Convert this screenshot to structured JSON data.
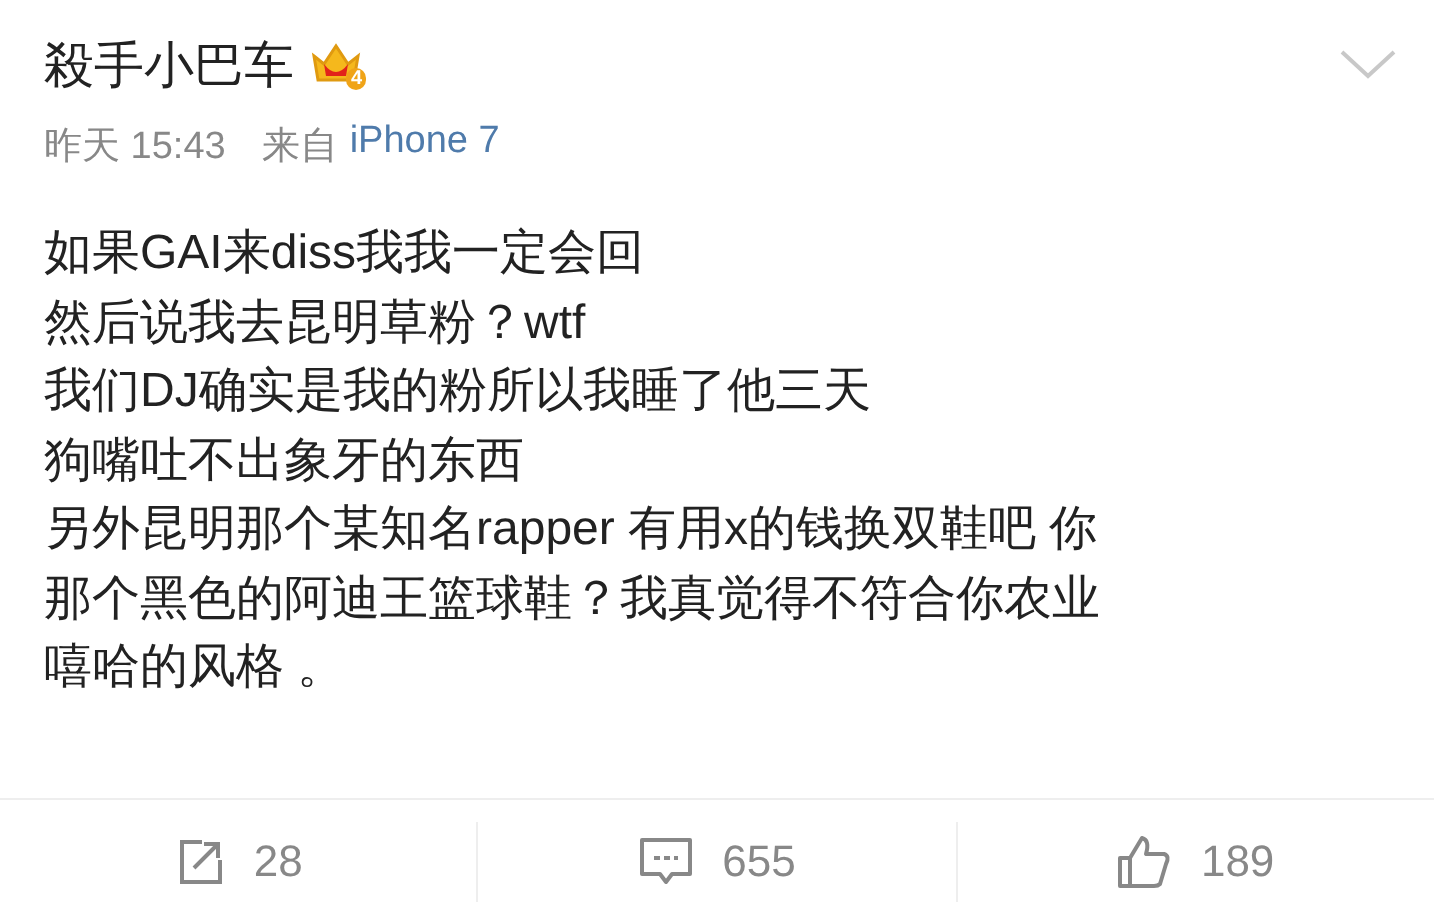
{
  "post": {
    "author": "殺手小巴车",
    "vip_level": "4",
    "time": "昨天 15:43",
    "source_prefix": "来自",
    "source": "iPhone 7",
    "lines": [
      "如果GAI来diss我我一定会回",
      "然后说我去昆明草粉？wtf",
      "我们DJ确实是我的粉所以我睡了他三天",
      "狗嘴吐不出象牙的东西",
      "另外昆明那个某知名rapper 有用x的钱换双鞋吧 你",
      "那个黑色的阿迪王篮球鞋？我真觉得不符合你农业",
      "嘻哈的风格 。"
    ]
  },
  "actions": [
    {
      "kind": "repost",
      "count": "28"
    },
    {
      "kind": "comment",
      "count": "655"
    },
    {
      "kind": "like",
      "count": "189"
    }
  ]
}
